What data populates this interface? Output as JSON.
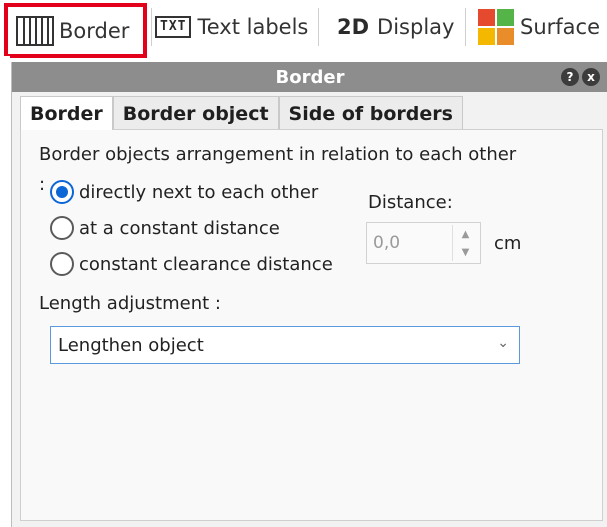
{
  "toolbar": {
    "border_label": "Border",
    "text_labels_label": "Text labels",
    "txt_icon_text": "TXT",
    "display2d_prefix": "2D",
    "display2d_label": "Display",
    "surface_label": "Surface"
  },
  "panel": {
    "title": "Border",
    "help_icon": "?",
    "close_icon": "x",
    "tabs": [
      {
        "label": "Border",
        "active": true
      },
      {
        "label": "Border object",
        "active": false
      },
      {
        "label": "Side of borders",
        "active": false
      }
    ],
    "arrangement_label": "Border objects arrangement in relation to each other",
    "arrangement_colon": ":",
    "options": [
      {
        "label": "directly next to each other",
        "checked": true
      },
      {
        "label": "at a constant distance",
        "checked": false
      },
      {
        "label": "constant clearance distance",
        "checked": false
      }
    ],
    "distance_label": "Distance:",
    "distance_value": "0,0",
    "distance_unit": "cm",
    "length_label": "Length adjustment :",
    "length_value": "Lengthen object"
  },
  "colors": {
    "highlight": "#e3001b",
    "accent": "#0b66d6",
    "header_bg": "#8d8d8d"
  }
}
